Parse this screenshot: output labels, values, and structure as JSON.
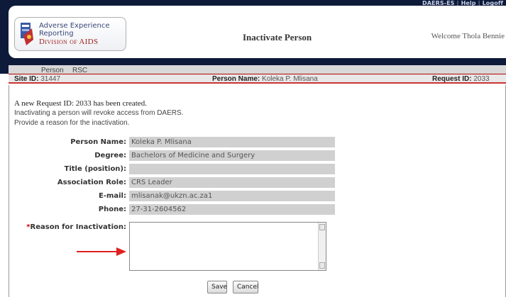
{
  "header": {
    "top_links": [
      "DAERS-ES",
      "Help",
      "Logoff"
    ],
    "logo": {
      "line1": "Adverse Experience",
      "line1b": "Reporting",
      "line2": "Division of AIDS",
      "icon": "daids-logo-icon"
    },
    "page_title": "Inactivate Person",
    "welcome": "Welcome Thola Bennie"
  },
  "tabs": [
    {
      "label": "Person"
    },
    {
      "label": "RSC"
    }
  ],
  "info_bar": {
    "site_label": "Site ID:",
    "site_value": "31447",
    "person_label": "Person Name:",
    "person_value": "Koleka P. Mlisana",
    "request_label": "Request ID:",
    "request_value": "2033"
  },
  "messages": {
    "created": "A new Request ID: 2033 has been created.",
    "revoke": "Inactivating a person will revoke access from DAERS.",
    "reason_prompt": "Provide a reason for the inactivation."
  },
  "form": {
    "fields": [
      {
        "label": "Person Name:",
        "value": "Koleka P. Mlisana"
      },
      {
        "label": "Degree:",
        "value": "Bachelors of Medicine and Surgery"
      },
      {
        "label": "Title (position):",
        "value": ""
      },
      {
        "label": "Association Role:",
        "value": "CRS Leader"
      },
      {
        "label": "E-mail:",
        "value": "mlisanak@ukzn.ac.za1"
      },
      {
        "label": "Phone:",
        "value": "27-31-2604562"
      }
    ],
    "reason_required_mark": "*",
    "reason_label": "Reason for Inactivation:",
    "reason_value": ""
  },
  "buttons": {
    "save": "Save",
    "cancel": "Cancel"
  },
  "colors": {
    "header_bg": "#0e1a3a",
    "accent_red": "#cc2222",
    "field_bg": "#d0d0d0",
    "annotation_arrow": "#e02020"
  }
}
